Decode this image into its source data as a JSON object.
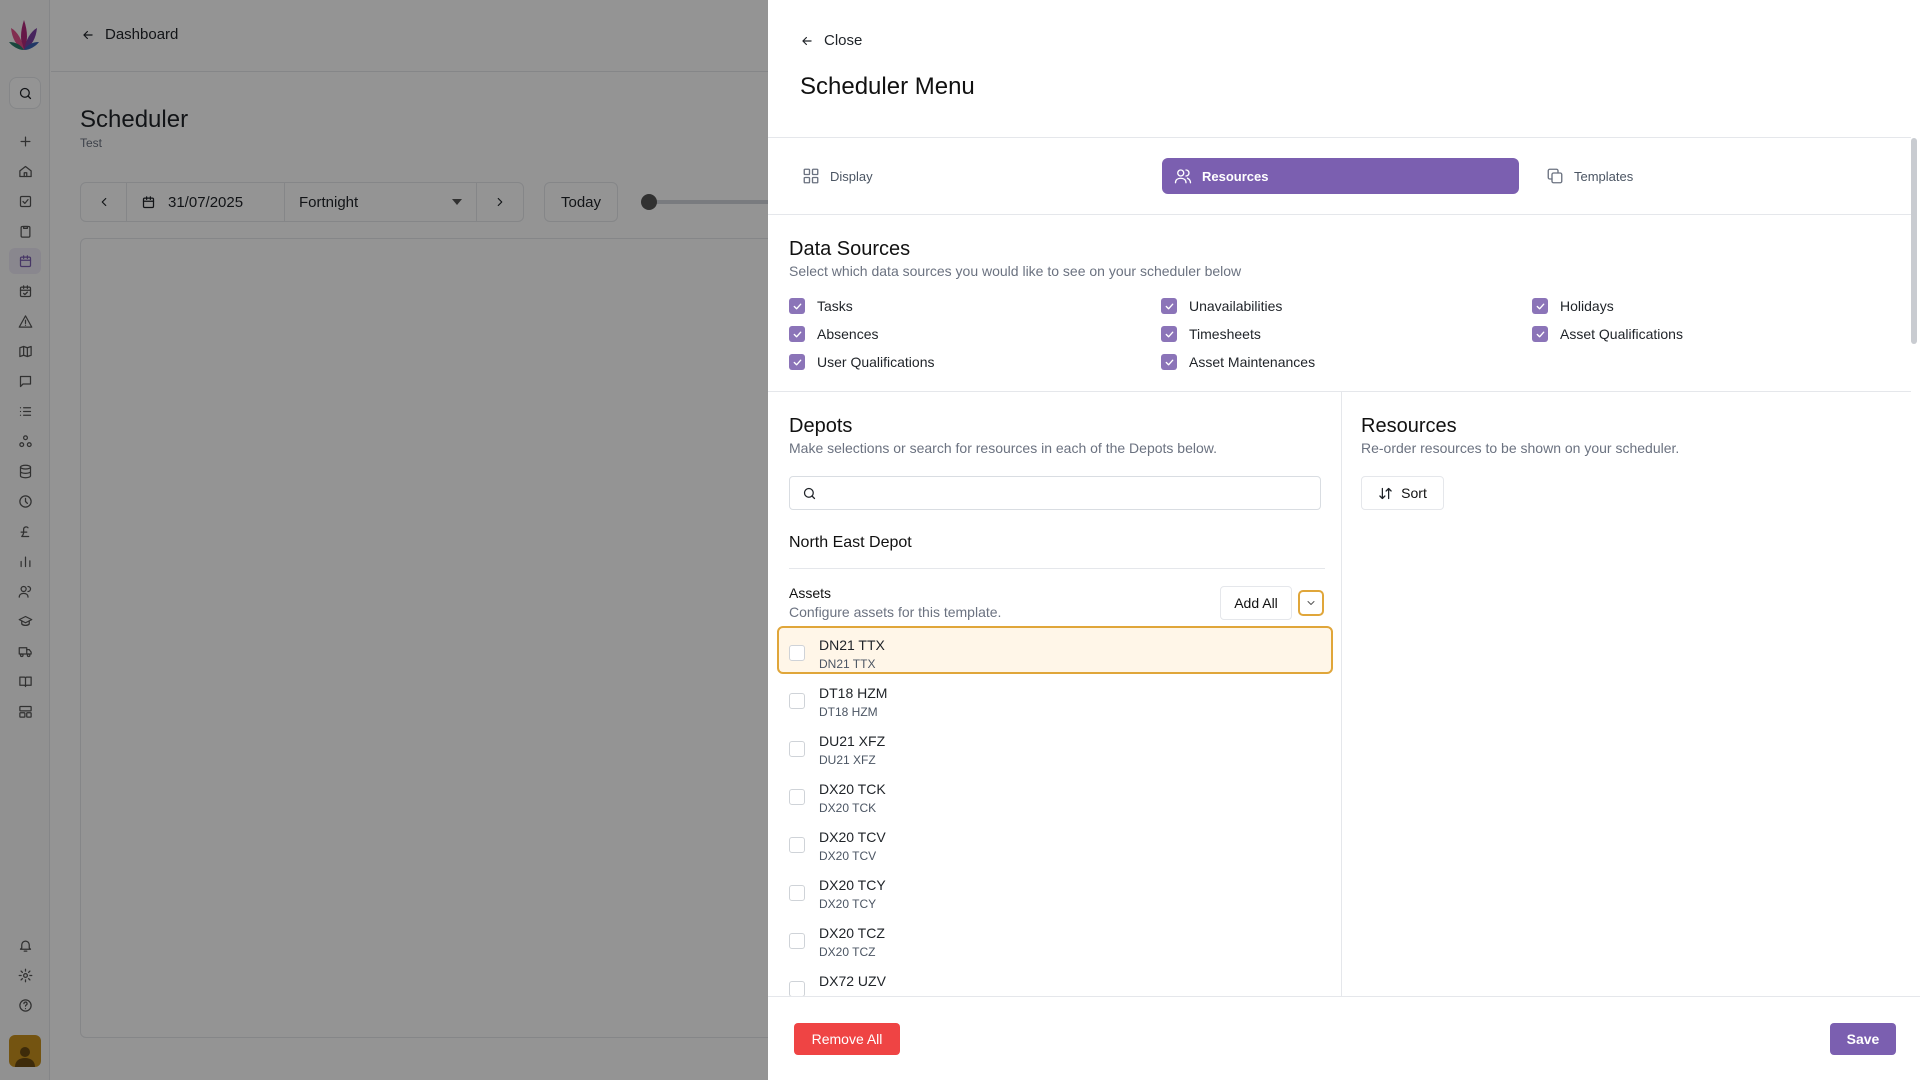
{
  "colors": {
    "accent": "#7b5fb0",
    "danger": "#ef4444",
    "focus": "#e0a63a"
  },
  "base_page": {
    "back_label": "Dashboard",
    "title": "Scheduler",
    "subtitle": "Test",
    "toolbar": {
      "date": "31/07/2025",
      "range": "Fortnight",
      "today_label": "Today"
    }
  },
  "rail": {
    "icons": [
      "plus-icon",
      "home-icon",
      "checkbox-icon",
      "clipboard-icon",
      "calendar-icon",
      "calendar-check-icon",
      "alert-icon",
      "map-icon",
      "message-icon",
      "list-icon",
      "network-icon",
      "database-icon",
      "clock-icon",
      "pound-icon",
      "chart-icon",
      "users-icon",
      "graduation-icon",
      "truck-icon",
      "book-icon",
      "layout-icon"
    ],
    "bottom_icons": [
      "bell-icon",
      "gear-icon",
      "help-icon"
    ]
  },
  "drawer": {
    "close_label": "Close",
    "title": "Scheduler Menu",
    "tabs": [
      {
        "label": "Display",
        "icon": "grid-icon",
        "active": false
      },
      {
        "label": "Resources",
        "icon": "users-icon",
        "active": true
      },
      {
        "label": "Templates",
        "icon": "copy-icon",
        "active": false
      }
    ],
    "data_sources": {
      "title": "Data Sources",
      "description": "Select which data sources you would like to see on your scheduler below",
      "items": [
        {
          "label": "Tasks",
          "checked": true
        },
        {
          "label": "Unavailabilities",
          "checked": true
        },
        {
          "label": "Holidays",
          "checked": true
        },
        {
          "label": "Absences",
          "checked": true
        },
        {
          "label": "Timesheets",
          "checked": true
        },
        {
          "label": "Asset Qualifications",
          "checked": true
        },
        {
          "label": "User Qualifications",
          "checked": true
        },
        {
          "label": "Asset Maintenances",
          "checked": true
        }
      ]
    },
    "depots": {
      "title": "Depots",
      "description": "Make selections or search for resources in each of the Depots below.",
      "search_placeholder": "",
      "depot_name": "North East Depot",
      "assets_label": "Assets",
      "assets_description": "Configure assets for this template.",
      "add_all_label": "Add All",
      "assets": [
        {
          "title": "DN21 TTX",
          "subtitle": "DN21 TTX",
          "checked": false,
          "highlighted": true
        },
        {
          "title": "DT18 HZM",
          "subtitle": "DT18 HZM",
          "checked": false,
          "highlighted": false
        },
        {
          "title": "DU21 XFZ",
          "subtitle": "DU21 XFZ",
          "checked": false,
          "highlighted": false
        },
        {
          "title": "DX20 TCK",
          "subtitle": "DX20 TCK",
          "checked": false,
          "highlighted": false
        },
        {
          "title": "DX20 TCV",
          "subtitle": "DX20 TCV",
          "checked": false,
          "highlighted": false
        },
        {
          "title": "DX20 TCY",
          "subtitle": "DX20 TCY",
          "checked": false,
          "highlighted": false
        },
        {
          "title": "DX20 TCZ",
          "subtitle": "DX20 TCZ",
          "checked": false,
          "highlighted": false
        },
        {
          "title": "DX72 UZV",
          "subtitle": "",
          "checked": false,
          "highlighted": false
        }
      ]
    },
    "resources": {
      "title": "Resources",
      "description": "Re-order resources to be shown on your scheduler.",
      "sort_label": "Sort"
    },
    "footer": {
      "remove_all_label": "Remove All",
      "save_label": "Save"
    }
  }
}
